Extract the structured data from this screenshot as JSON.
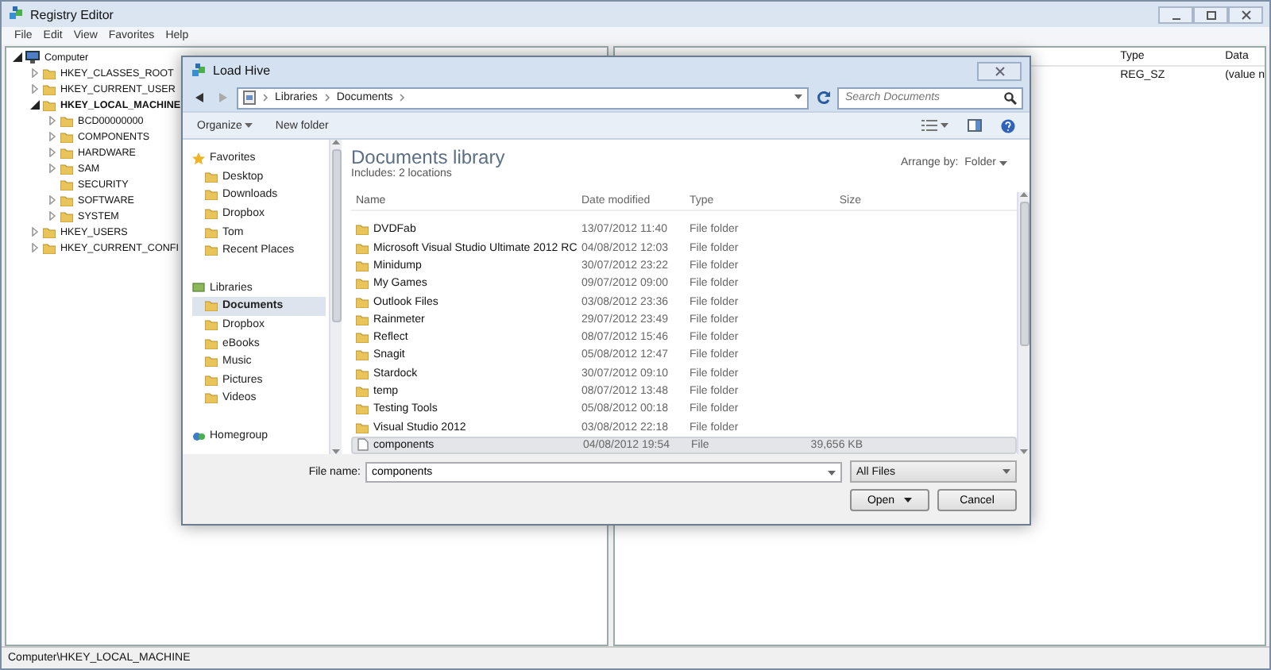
{
  "window": {
    "title": "Registry Editor",
    "menu": [
      "File",
      "Edit",
      "View",
      "Favorites",
      "Help"
    ]
  },
  "tree": [
    {
      "label": "Computer",
      "expanded": true,
      "selected": false,
      "children": [
        {
          "label": "HKEY_CLASSES_ROOT",
          "expanded": false,
          "selected": false
        },
        {
          "label": "HKEY_CURRENT_USER",
          "expanded": false,
          "selected": false
        },
        {
          "label": "HKEY_LOCAL_MACHINE",
          "expanded": true,
          "selected": true,
          "children": [
            {
              "label": "BCD00000000",
              "expanded": false,
              "selected": false
            },
            {
              "label": "COMPONENTS",
              "expanded": false,
              "selected": false
            },
            {
              "label": "HARDWARE",
              "expanded": false,
              "selected": false
            },
            {
              "label": "SAM",
              "expanded": false,
              "selected": false
            },
            {
              "label": "SECURITY",
              "selected": false
            },
            {
              "label": "SOFTWARE",
              "expanded": false,
              "selected": false
            },
            {
              "label": "SYSTEM",
              "expanded": false,
              "selected": false
            }
          ]
        },
        {
          "label": "HKEY_USERS",
          "expanded": false,
          "selected": false
        },
        {
          "label": "HKEY_CURRENT_CONFI",
          "expanded": false,
          "selected": false
        }
      ]
    }
  ],
  "values": {
    "columns": [
      "Type",
      "Data"
    ],
    "rows": [
      [
        "REG_SZ",
        "(value n"
      ]
    ]
  },
  "status_bar": "Computer\\HKEY_LOCAL_MACHINE",
  "dialog": {
    "title": "Load Hive",
    "breadcrumb": [
      "Libraries",
      "Documents"
    ],
    "search": {
      "placeholder": "Search Documents"
    },
    "toolbar": [
      "Organize",
      "New folder"
    ],
    "nav": [
      {
        "label": "Favorites",
        "kind": "group",
        "selected": false
      },
      {
        "label": "Desktop",
        "kind": "item",
        "selected": false
      },
      {
        "label": "Downloads",
        "kind": "item",
        "selected": false
      },
      {
        "label": "Dropbox",
        "kind": "item",
        "selected": false
      },
      {
        "label": "Tom",
        "kind": "item",
        "selected": false
      },
      {
        "label": "Recent Places",
        "kind": "item",
        "selected": false
      },
      {
        "label": "Libraries",
        "kind": "group",
        "selected": false
      },
      {
        "label": "Documents",
        "kind": "item",
        "selected": true
      },
      {
        "label": "Dropbox",
        "kind": "item",
        "selected": false
      },
      {
        "label": "eBooks",
        "kind": "item",
        "selected": false
      },
      {
        "label": "Music",
        "kind": "item",
        "selected": false
      },
      {
        "label": "Pictures",
        "kind": "item",
        "selected": false
      },
      {
        "label": "Videos",
        "kind": "item",
        "selected": false
      },
      {
        "label": "Homegroup",
        "kind": "group",
        "selected": false
      }
    ],
    "library": {
      "title": "Documents library",
      "includes": "Includes: 2 locations",
      "arrange_label": "Arrange by:",
      "arrange_value": "Folder"
    },
    "columns": [
      "Name",
      "Date modified",
      "Type",
      "Size"
    ],
    "files": [
      {
        "name": "DVDFab",
        "date": "13/07/2012 11:40",
        "type": "File folder",
        "kind": "folder",
        "selected": false
      },
      {
        "name": "Microsoft Visual Studio Ultimate 2012 RC",
        "date": "04/08/2012 12:03",
        "type": "File folder",
        "kind": "folder",
        "selected": false
      },
      {
        "name": "Minidump",
        "date": "30/07/2012 23:22",
        "type": "File folder",
        "kind": "folder",
        "selected": false
      },
      {
        "name": "My Games",
        "date": "09/07/2012 09:00",
        "type": "File folder",
        "kind": "folder",
        "selected": false
      },
      {
        "name": "Outlook Files",
        "date": "03/08/2012 23:36",
        "type": "File folder",
        "kind": "folder",
        "selected": false
      },
      {
        "name": "Rainmeter",
        "date": "29/07/2012 23:49",
        "type": "File folder",
        "kind": "folder",
        "selected": false
      },
      {
        "name": "Reflect",
        "date": "08/07/2012 15:46",
        "type": "File folder",
        "kind": "folder",
        "selected": false
      },
      {
        "name": "Snagit",
        "date": "05/08/2012 12:47",
        "type": "File folder",
        "kind": "folder",
        "selected": false
      },
      {
        "name": "Stardock",
        "date": "30/07/2012 09:10",
        "type": "File folder",
        "kind": "folder",
        "selected": false
      },
      {
        "name": "temp",
        "date": "08/07/2012 13:48",
        "type": "File folder",
        "kind": "folder",
        "selected": false
      },
      {
        "name": "Testing Tools",
        "date": "05/08/2012 00:18",
        "type": "File folder",
        "kind": "folder",
        "selected": false
      },
      {
        "name": "Visual Studio 2012",
        "date": "03/08/2012 22:18",
        "type": "File folder",
        "kind": "folder",
        "selected": false
      },
      {
        "name": "components",
        "date": "04/08/2012 19:54",
        "type": "File",
        "size": "39,656 KB",
        "kind": "file",
        "selected": true
      }
    ],
    "filename": {
      "label": "File name:",
      "value": "components"
    },
    "filter": "All Files",
    "buttons": [
      "Open",
      "Cancel"
    ]
  }
}
